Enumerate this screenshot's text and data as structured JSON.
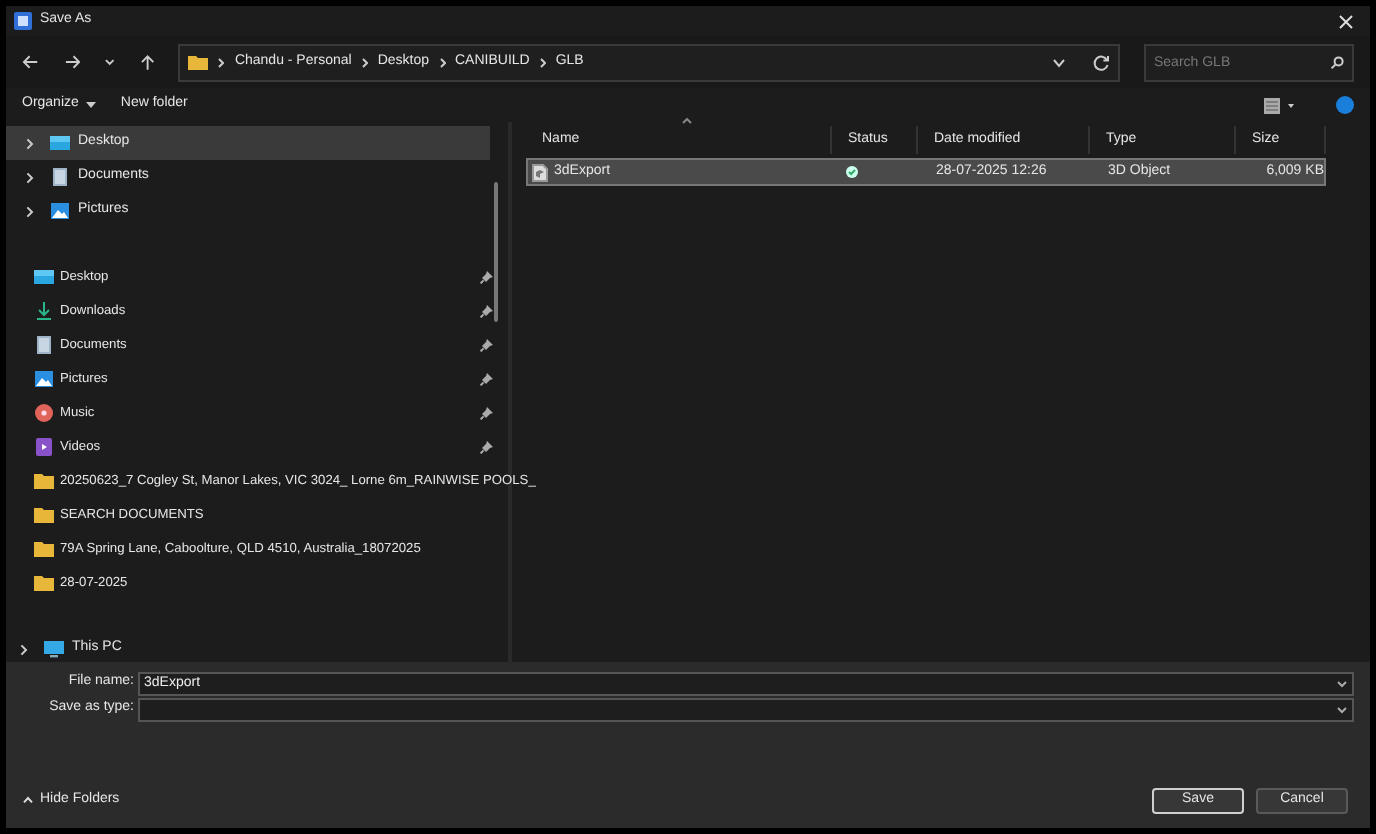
{
  "window": {
    "title": "Save As"
  },
  "address_bar": {
    "path": [
      "Chandu - Personal",
      "Desktop",
      "CANIBUILD",
      "GLB"
    ],
    "search_placeholder": "Search GLB"
  },
  "command_bar": {
    "organize": "Organize",
    "new_folder": "New folder"
  },
  "sidebar": {
    "tree": [
      {
        "label": "Desktop",
        "kind": "desktop",
        "selected": true
      },
      {
        "label": "Documents",
        "kind": "documents",
        "selected": false
      },
      {
        "label": "Pictures",
        "kind": "pictures",
        "selected": false
      }
    ],
    "quick_access": [
      {
        "label": "Desktop",
        "kind": "desktop",
        "pinned": true
      },
      {
        "label": "Downloads",
        "kind": "downloads",
        "pinned": true
      },
      {
        "label": "Documents",
        "kind": "documents",
        "pinned": true
      },
      {
        "label": "Pictures",
        "kind": "pictures",
        "pinned": true
      },
      {
        "label": "Music",
        "kind": "music",
        "pinned": true
      },
      {
        "label": "Videos",
        "kind": "videos",
        "pinned": true
      },
      {
        "label": "20250623_7 Cogley St, Manor Lakes, VIC 3024_ Lorne 6m_RAINWISE POOLS_",
        "kind": "folder",
        "pinned": false
      },
      {
        "label": "SEARCH DOCUMENTS",
        "kind": "folder",
        "pinned": false
      },
      {
        "label": "79A Spring Lane, Caboolture, QLD 4510, Australia_18072025",
        "kind": "folder",
        "pinned": false
      },
      {
        "label": "28-07-2025",
        "kind": "folder",
        "pinned": false
      }
    ],
    "this_pc": {
      "label": "This PC",
      "kind": "pc"
    }
  },
  "file_list": {
    "columns": [
      "Name",
      "Status",
      "Date modified",
      "Type",
      "Size"
    ],
    "rows": [
      {
        "name": "3dExport",
        "synced": true,
        "date": "28-07-2025 12:26",
        "type": "3D Object",
        "size": "6,009 KB",
        "selected": true
      }
    ]
  },
  "save_panel": {
    "file_name_label": "File name:",
    "file_name": "3dExport",
    "type_label": "Save as type:",
    "hide_folders": "Hide Folders",
    "buttons": [
      "Save",
      "Cancel"
    ]
  }
}
